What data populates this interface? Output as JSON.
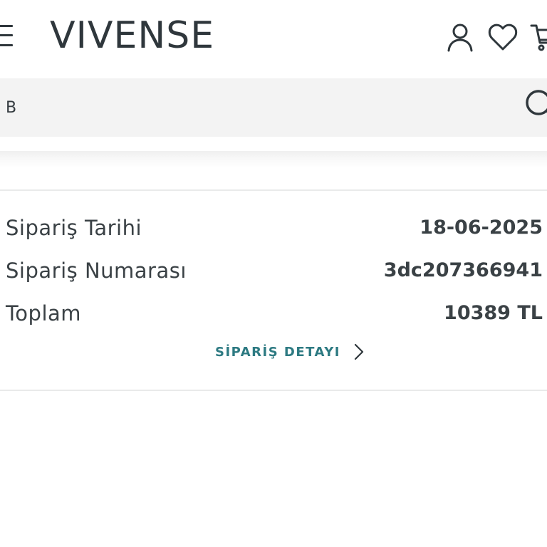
{
  "header": {
    "logo": "VIVENSE",
    "icons": {
      "menu": "menu-icon",
      "account": "user-icon",
      "wishlist": "heart-icon",
      "cart": "cart-icon"
    }
  },
  "search": {
    "value": "B",
    "icon": "search-icon"
  },
  "order": {
    "rows": [
      {
        "label": "Sipariş Tarihi",
        "value": "18-06-2025"
      },
      {
        "label": "Sipariş Numarası",
        "value": "3dc207366941"
      },
      {
        "label": "Toplam",
        "value": "10389 TL"
      }
    ],
    "detail_link": "SİPARİŞ DETAYI"
  },
  "colors": {
    "text": "#3a4145",
    "accent": "#2d7a82",
    "search_bg": "#f3f3f3",
    "divider": "#e9eaea"
  }
}
